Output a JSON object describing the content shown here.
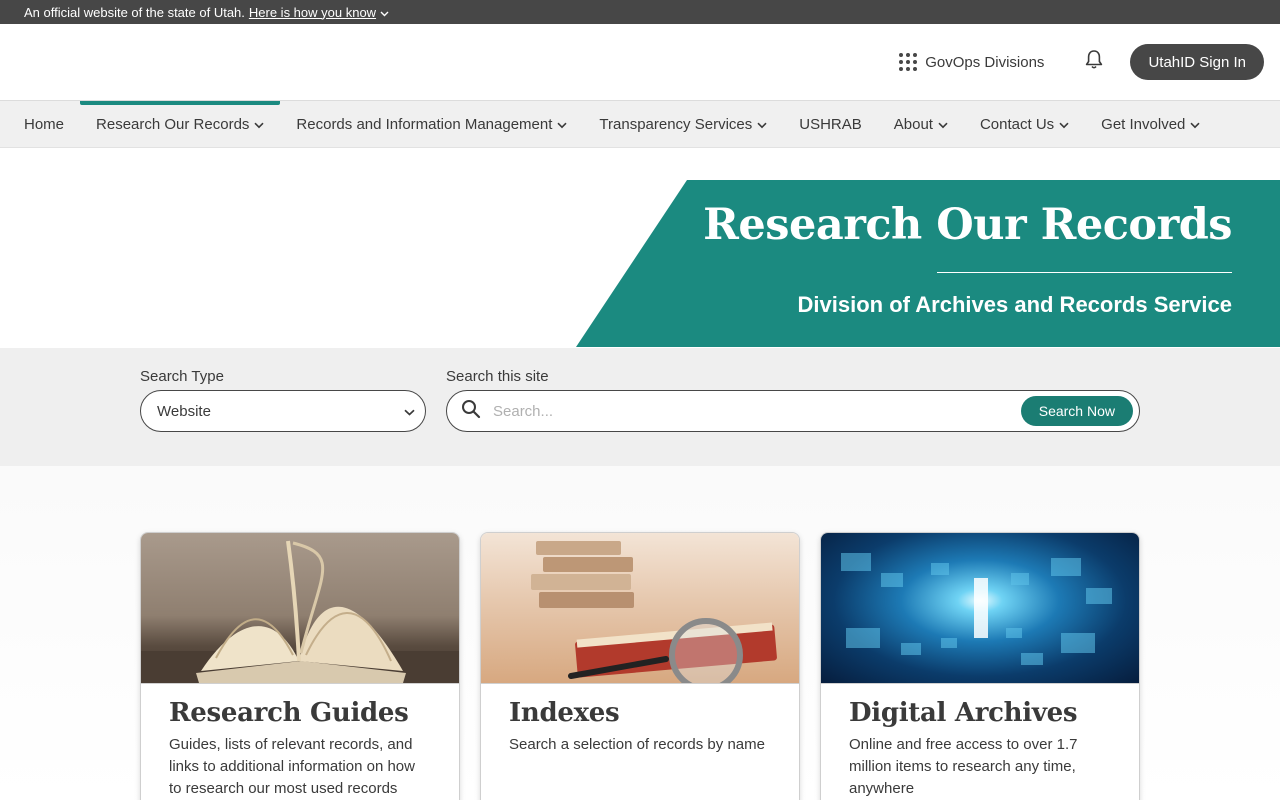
{
  "official_banner": {
    "text": "An official website of the state of Utah.",
    "link": "Here is how you know"
  },
  "header": {
    "divisions_label": "GovOps Divisions",
    "signin_label": "UtahID Sign In"
  },
  "nav": {
    "items": [
      {
        "label": "Home"
      },
      {
        "label": "Research Our Records"
      },
      {
        "label": "Records and Information Management"
      },
      {
        "label": "Transparency Services"
      },
      {
        "label": "USHRAB"
      },
      {
        "label": "About"
      },
      {
        "label": "Contact Us"
      },
      {
        "label": "Get Involved"
      }
    ],
    "active_index": 1
  },
  "hero": {
    "title": "Research Our Records",
    "subtitle": "Division of Archives and Records Service"
  },
  "search": {
    "type_label": "Search Type",
    "type_value": "Website",
    "site_label": "Search this site",
    "placeholder": "Search...",
    "button_label": "Search Now"
  },
  "cards": [
    {
      "title": "Research Guides",
      "description": "Guides, lists of relevant records, and links to additional information on how to research our most used records"
    },
    {
      "title": "Indexes",
      "description": "Search a selection of records by name"
    },
    {
      "title": "Digital Archives",
      "description": "Online and free access to over 1.7 million items to research any time, anywhere"
    }
  ],
  "colors": {
    "accent": "#1b8a80",
    "dark": "#474747",
    "band": "#efefef"
  }
}
